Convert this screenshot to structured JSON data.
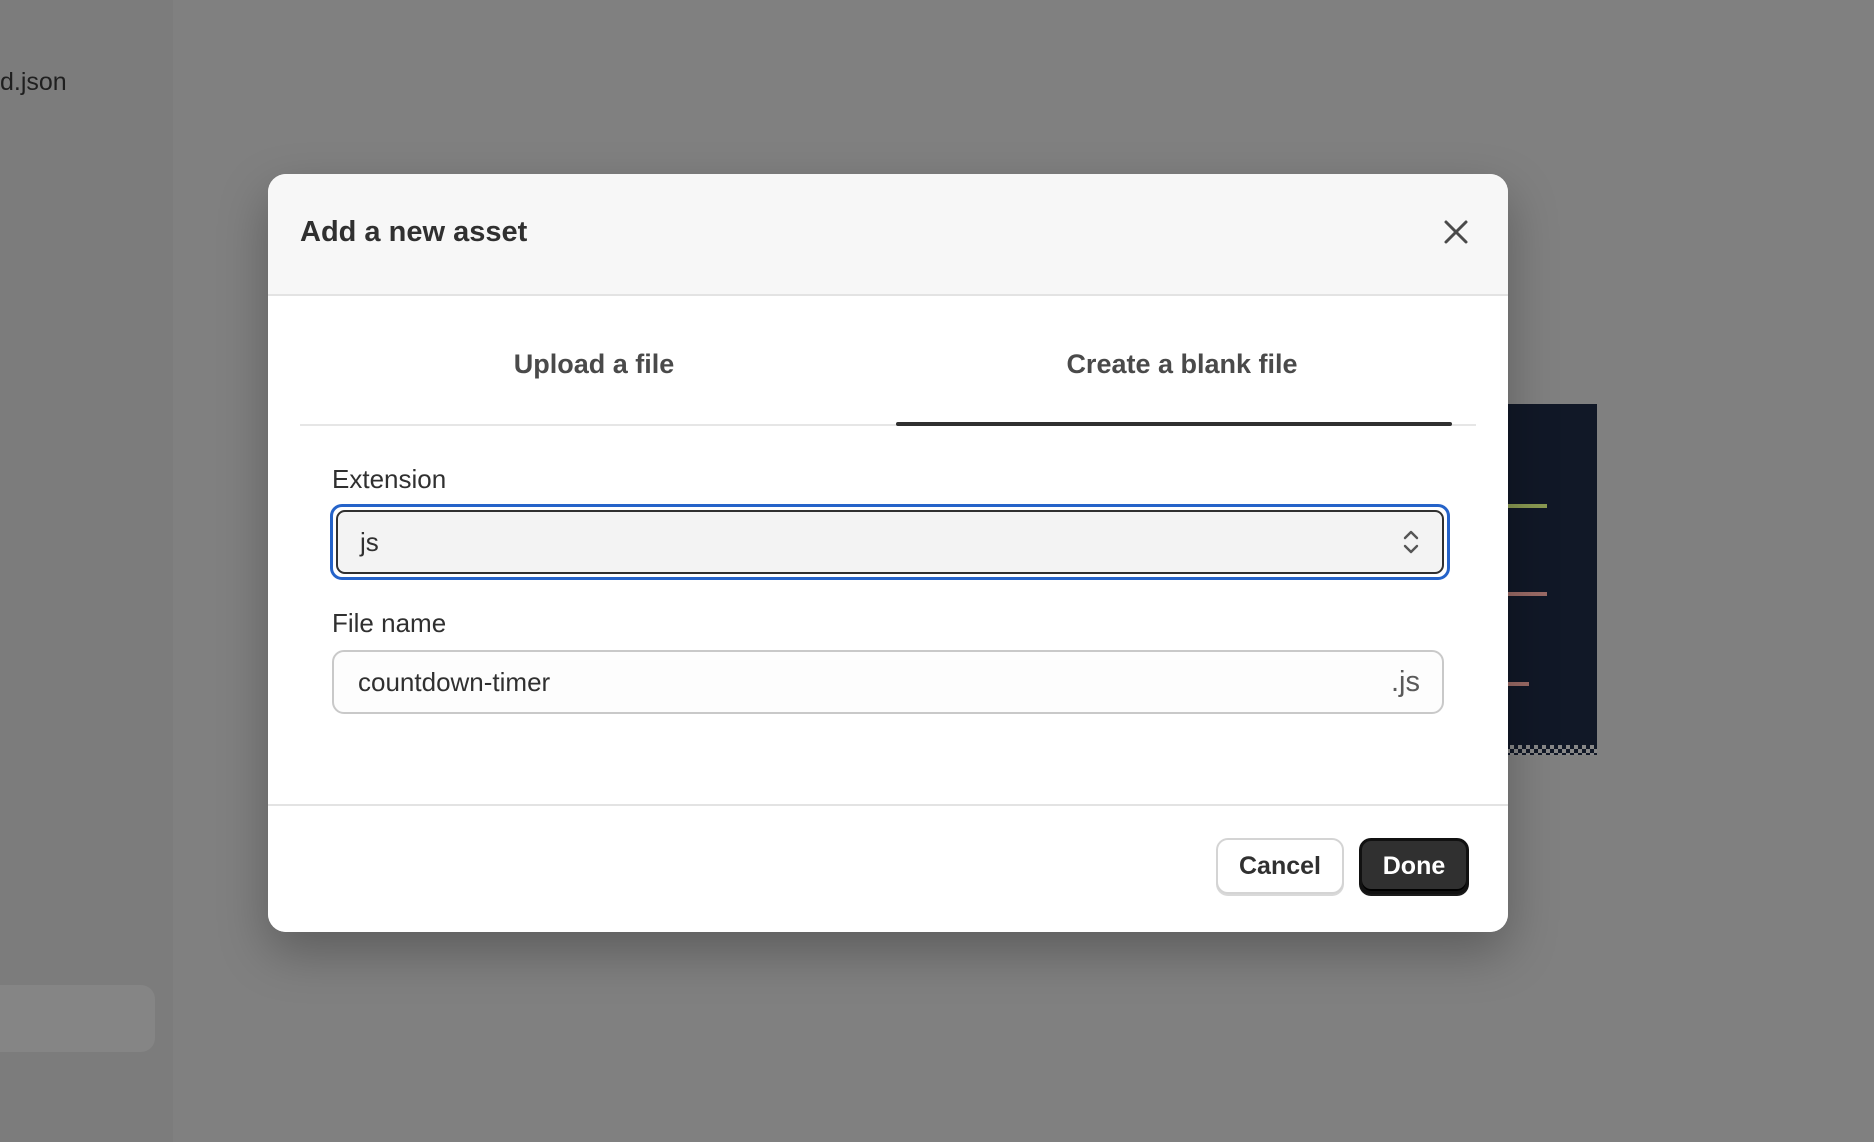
{
  "background": {
    "sidebar_file_label": "d.json"
  },
  "modal": {
    "title": "Add a new asset",
    "close_icon": "close-icon",
    "tabs": [
      {
        "label": "Upload a file",
        "active": false
      },
      {
        "label": "Create a blank file",
        "active": true
      }
    ],
    "extension": {
      "label": "Extension",
      "value": "js",
      "icon": "chevron-up-down-icon"
    },
    "file_name": {
      "label": "File name",
      "value": "countdown-timer",
      "suffix": ".js"
    },
    "footer": {
      "cancel_label": "Cancel",
      "done_label": "Done"
    }
  },
  "colors": {
    "focus_ring": "#2563c9",
    "primary_button": "#303030",
    "overlay": "#7f7f7f"
  }
}
